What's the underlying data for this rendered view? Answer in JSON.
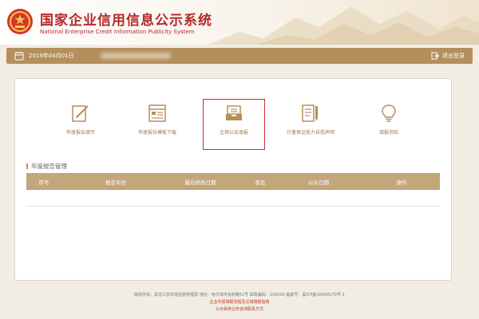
{
  "header": {
    "title_cn": "国家企业信用信息公示系统",
    "title_en": "National Enterprise Credit Information Publicity System"
  },
  "topbar": {
    "date": "2019年04月01日",
    "logout_label": "退出登录"
  },
  "tiles": [
    {
      "label": "年度报告填写",
      "icon": "pencil-note-icon"
    },
    {
      "label": "年度报告模板下载",
      "icon": "document-template-icon"
    },
    {
      "label": "注销公告填报",
      "icon": "inbox-tray-icon",
      "selected": true
    },
    {
      "label": "计量保证能力自我声明",
      "icon": "document-pencil-icon"
    },
    {
      "label": "填报须知",
      "icon": "lightbulb-icon"
    }
  ],
  "report_section": {
    "title": "年度报告管理",
    "columns": [
      "序号",
      "报告年份",
      "最后修改日期",
      "状态",
      "公示日期",
      "操作"
    ]
  },
  "footer": {
    "line1": "版权所有：黑龙江省市场监督管理局  地址：哈尔滨市省府路51号 邮政编码：150000  备案号：黑ICP备16000170号-1",
    "link1": "企业年报填报流程及注销填报指南",
    "link2": "公示系统业务咨询联系方式"
  },
  "colors": {
    "brand_red": "#b4292a",
    "gold_bar": "#b48f5c",
    "table_head": "#c3a679",
    "tile_label": "#a0794a",
    "selection_border": "#d42b2b"
  }
}
